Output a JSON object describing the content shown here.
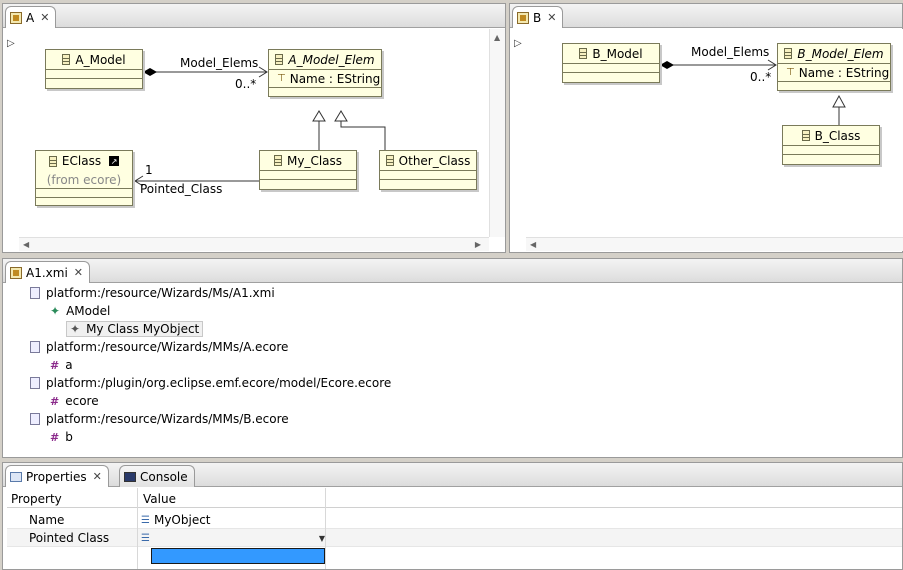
{
  "editor_a": {
    "tab_label": "A",
    "classes": {
      "a_model": "A_Model",
      "a_model_elem": "A_Model_Elem",
      "a_model_elem_attr": "Name : EString",
      "eclass": "EClass",
      "eclass_from": "(from ecore)",
      "my_class": "My_Class",
      "other_class": "Other_Class"
    },
    "labels": {
      "model_elems": "Model_Elems",
      "model_elems_mult": "0..*",
      "pointed_class": "Pointed_Class",
      "pointed_mult": "1"
    }
  },
  "editor_b": {
    "tab_label": "B",
    "classes": {
      "b_model": "B_Model",
      "b_model_elem": "B_Model_Elem",
      "b_model_elem_attr": "Name : EString",
      "b_class": "B_Class"
    },
    "labels": {
      "model_elems": "Model_Elems",
      "model_elems_mult": "0..*"
    }
  },
  "xmi_editor": {
    "tab_label": "A1.xmi",
    "tree": [
      {
        "label": "platform:/resource/Wizards/Ms/A1.xmi"
      },
      {
        "label": "AModel"
      },
      {
        "label": "My Class MyObject"
      },
      {
        "label": "platform:/resource/Wizards/MMs/A.ecore"
      },
      {
        "label": "a"
      },
      {
        "label": "platform:/plugin/org.eclipse.emf.ecore/model/Ecore.ecore"
      },
      {
        "label": "ecore"
      },
      {
        "label": "platform:/resource/Wizards/MMs/B.ecore"
      },
      {
        "label": "b"
      }
    ]
  },
  "bottom_tabs": {
    "properties": "Properties",
    "console": "Console"
  },
  "properties": {
    "col_property": "Property",
    "col_value": "Value",
    "rows": [
      {
        "property": "Name",
        "value": "MyObject"
      },
      {
        "property": "Pointed Class",
        "value": ""
      }
    ],
    "selection_color": "#3399ff"
  }
}
